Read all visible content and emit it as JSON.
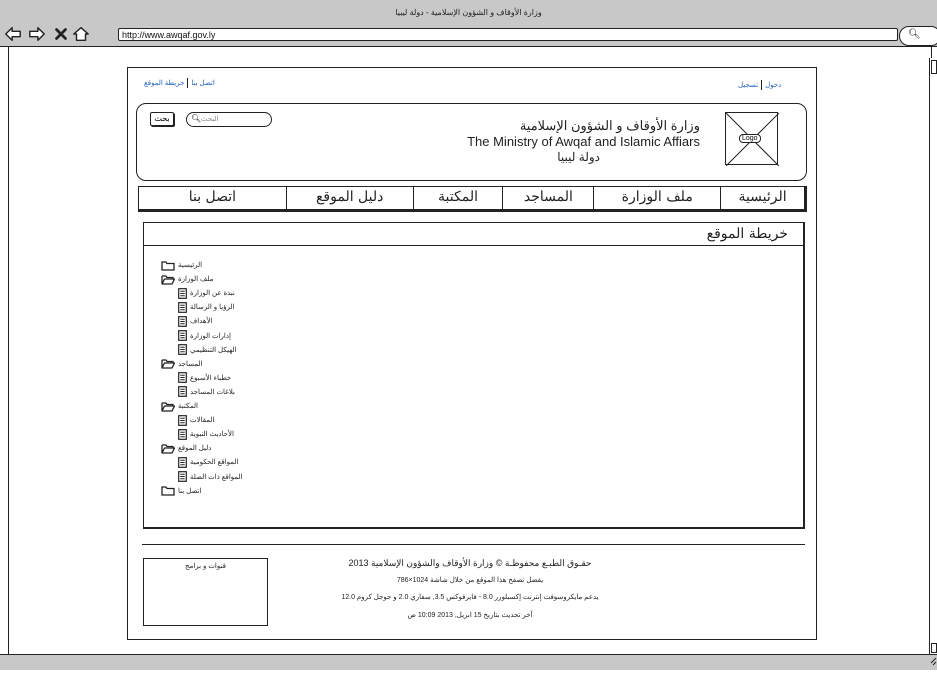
{
  "window": {
    "title": "وزارة الأوقاف و الشؤون الإسلامية - دولة ليبيا",
    "url": "http://www.awqaf.gov.ly"
  },
  "top_links": {
    "contact": "اتصل بنا",
    "sitemap": "خريطة الموقع",
    "login": "دخول",
    "register": "تسجيل"
  },
  "header": {
    "search_button": "بحث",
    "search_placeholder": "البحث",
    "title_ar": "وزارة الأوقاف و الشؤون الإسلامية",
    "title_en": "The Ministry of Awqaf and Islamic Affiars",
    "country": "دولة ليبيا",
    "logo_label": "Logo"
  },
  "nav": {
    "items": [
      "الرئيسية",
      "ملف الوزارة",
      "المساجد",
      "المكتبة",
      "دليل الموقع",
      "اتصل بنا"
    ]
  },
  "sitemap": {
    "title": "خريطة الموقع",
    "tree": [
      {
        "label": "الرئيسية",
        "type": "folder"
      },
      {
        "label": "ملف الوزارة",
        "type": "folder-open"
      },
      {
        "label": "نبذة عن الوزارة",
        "type": "doc"
      },
      {
        "label": "الرؤيا و الرسالة",
        "type": "doc"
      },
      {
        "label": "الأهداف",
        "type": "doc"
      },
      {
        "label": "إدارات الوزارة",
        "type": "doc"
      },
      {
        "label": "الهيكل التنظيمي",
        "type": "doc"
      },
      {
        "label": "المساجد",
        "type": "folder-open"
      },
      {
        "label": "خطباء الأسبوع",
        "type": "doc"
      },
      {
        "label": "بلاغات المساجد",
        "type": "doc"
      },
      {
        "label": "المكتبة",
        "type": "folder-open"
      },
      {
        "label": "المقالات",
        "type": "doc"
      },
      {
        "label": "الأحاديث النبوية",
        "type": "doc"
      },
      {
        "label": "دليل الموقع",
        "type": "folder-open"
      },
      {
        "label": "المواقع الحكومية",
        "type": "doc"
      },
      {
        "label": "المواقع ذات الصلة",
        "type": "doc"
      },
      {
        "label": "اتصل بنا",
        "type": "folder"
      }
    ]
  },
  "footer": {
    "channels": "قنوات و برامج",
    "copyright": "حقـوق الطبـع محفوظـة © وزارة الأوقاف والشؤون الإسلامية 2013",
    "resolution": "يفضل تصفح هذا الموقع من خلال شاشة 1024×786",
    "browsers": "يدعم مايكروسوفت إنترنت إكسبلورر 8.0 - فايرفوكس 3.5, سفاري 2.0 و جوجل كروم 12.0",
    "updated": "آخر تحديث بتاريخ 15 ابريل, 2013 10:09 ص"
  }
}
